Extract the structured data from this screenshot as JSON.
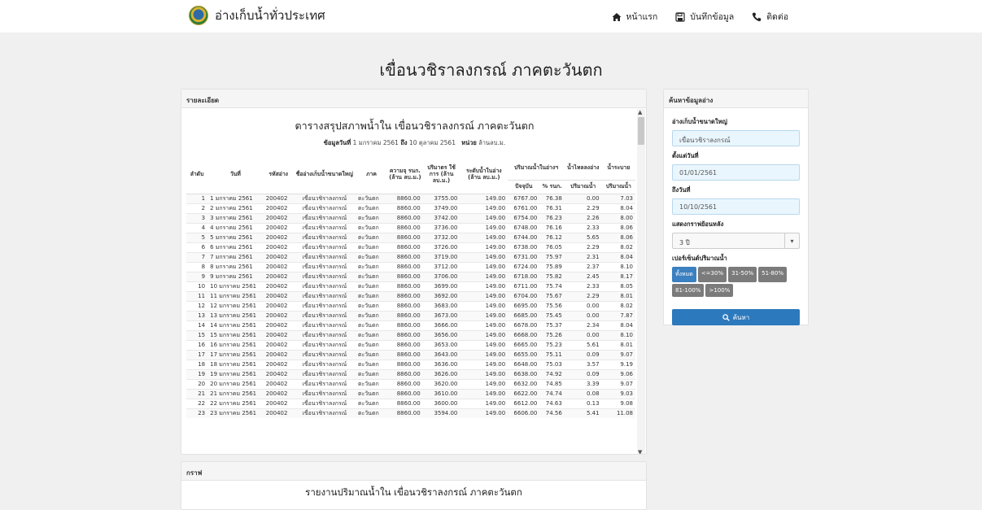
{
  "nav": {
    "brand": "อ่างเก็บน้ำทั่วประเทศ",
    "home": "หน้าแรก",
    "record": "บันทึกข้อมูล",
    "contact": "ติดต่อ"
  },
  "page_title": "เขื่อนวชิราลงกรณ์ ภาคตะวันตก",
  "detail": {
    "heading": "รายละเอียด",
    "report_title": "ตารางสรุปสภาพน้ำใน เขื่อนวชิราลงกรณ์ ภาคตะวันตก",
    "sub_label_date": "ข้อมูลวันที่",
    "sub_date_from": "1 มกราคม 2561",
    "sub_label_to": "ถึง",
    "sub_date_to": "10 ตุลาคม 2561",
    "sub_label_unit": "หน่วย",
    "sub_unit": "ล้านลบ.ม.",
    "columns": {
      "no": "ลำดับ",
      "date": "วันที่",
      "code": "รหัสอ่าง",
      "name": "ชื่ออ่างเก็บน้ำขนาดใหญ่",
      "region": "ภาค",
      "capacity": "ความจุ รนก. (ล้าน ลบ.ม.)",
      "usable": "ปริมาตร ใช้การ (ล้าน ลบ.ม.)",
      "min_level": "ระดับน้ำในอ่าง (ล้าน ลบ.ม.)",
      "storage_group": "ปริมาณน้ำในอ่างฯ",
      "current": "ปัจจุบัน",
      "percent": "% รนก.",
      "inflow_group": "น้ำไหลลงอ่าง",
      "inflow": "ปริมาณน้ำ",
      "release_group": "น้ำระบาย",
      "release": "ปริมาณน้ำ"
    },
    "rows": [
      [
        "1",
        "1 มกราคม 2561",
        "200402",
        "เขื่อนวชิราลงกรณ์",
        "ตะวันตก",
        "8860.00",
        "3755.00",
        "149.00",
        "6767.00",
        "76.38",
        "0.00",
        "7.03"
      ],
      [
        "2",
        "2 มกราคม 2561",
        "200402",
        "เขื่อนวชิราลงกรณ์",
        "ตะวันตก",
        "8860.00",
        "3749.00",
        "149.00",
        "6761.00",
        "76.31",
        "2.29",
        "8.04"
      ],
      [
        "3",
        "3 มกราคม 2561",
        "200402",
        "เขื่อนวชิราลงกรณ์",
        "ตะวันตก",
        "8860.00",
        "3742.00",
        "149.00",
        "6754.00",
        "76.23",
        "2.26",
        "8.00"
      ],
      [
        "4",
        "4 มกราคม 2561",
        "200402",
        "เขื่อนวชิราลงกรณ์",
        "ตะวันตก",
        "8860.00",
        "3736.00",
        "149.00",
        "6748.00",
        "76.16",
        "2.33",
        "8.06"
      ],
      [
        "5",
        "5 มกราคม 2561",
        "200402",
        "เขื่อนวชิราลงกรณ์",
        "ตะวันตก",
        "8860.00",
        "3732.00",
        "149.00",
        "6744.00",
        "76.12",
        "5.65",
        "8.06"
      ],
      [
        "6",
        "6 มกราคม 2561",
        "200402",
        "เขื่อนวชิราลงกรณ์",
        "ตะวันตก",
        "8860.00",
        "3726.00",
        "149.00",
        "6738.00",
        "76.05",
        "2.29",
        "8.02"
      ],
      [
        "7",
        "7 มกราคม 2561",
        "200402",
        "เขื่อนวชิราลงกรณ์",
        "ตะวันตก",
        "8860.00",
        "3719.00",
        "149.00",
        "6731.00",
        "75.97",
        "2.31",
        "8.04"
      ],
      [
        "8",
        "8 มกราคม 2561",
        "200402",
        "เขื่อนวชิราลงกรณ์",
        "ตะวันตก",
        "8860.00",
        "3712.00",
        "149.00",
        "6724.00",
        "75.89",
        "2.37",
        "8.10"
      ],
      [
        "9",
        "9 มกราคม 2561",
        "200402",
        "เขื่อนวชิราลงกรณ์",
        "ตะวันตก",
        "8860.00",
        "3706.00",
        "149.00",
        "6718.00",
        "75.82",
        "2.45",
        "8.17"
      ],
      [
        "10",
        "10 มกราคม 2561",
        "200402",
        "เขื่อนวชิราลงกรณ์",
        "ตะวันตก",
        "8860.00",
        "3699.00",
        "149.00",
        "6711.00",
        "75.74",
        "2.33",
        "8.05"
      ],
      [
        "11",
        "11 มกราคม 2561",
        "200402",
        "เขื่อนวชิราลงกรณ์",
        "ตะวันตก",
        "8860.00",
        "3692.00",
        "149.00",
        "6704.00",
        "75.67",
        "2.29",
        "8.01"
      ],
      [
        "12",
        "12 มกราคม 2561",
        "200402",
        "เขื่อนวชิราลงกรณ์",
        "ตะวันตก",
        "8860.00",
        "3683.00",
        "149.00",
        "6695.00",
        "75.56",
        "0.00",
        "8.02"
      ],
      [
        "13",
        "13 มกราคม 2561",
        "200402",
        "เขื่อนวชิราลงกรณ์",
        "ตะวันตก",
        "8860.00",
        "3673.00",
        "149.00",
        "6685.00",
        "75.45",
        "0.00",
        "7.87"
      ],
      [
        "14",
        "14 มกราคม 2561",
        "200402",
        "เขื่อนวชิราลงกรณ์",
        "ตะวันตก",
        "8860.00",
        "3666.00",
        "149.00",
        "6678.00",
        "75.37",
        "2.34",
        "8.04"
      ],
      [
        "15",
        "15 มกราคม 2561",
        "200402",
        "เขื่อนวชิราลงกรณ์",
        "ตะวันตก",
        "8860.00",
        "3656.00",
        "149.00",
        "6668.00",
        "75.26",
        "0.00",
        "8.10"
      ],
      [
        "16",
        "16 มกราคม 2561",
        "200402",
        "เขื่อนวชิราลงกรณ์",
        "ตะวันตก",
        "8860.00",
        "3653.00",
        "149.00",
        "6665.00",
        "75.23",
        "5.61",
        "8.01"
      ],
      [
        "17",
        "17 มกราคม 2561",
        "200402",
        "เขื่อนวชิราลงกรณ์",
        "ตะวันตก",
        "8860.00",
        "3643.00",
        "149.00",
        "6655.00",
        "75.11",
        "0.09",
        "9.07"
      ],
      [
        "18",
        "18 มกราคม 2561",
        "200402",
        "เขื่อนวชิราลงกรณ์",
        "ตะวันตก",
        "8860.00",
        "3636.00",
        "149.00",
        "6648.00",
        "75.03",
        "3.57",
        "9.19"
      ],
      [
        "19",
        "19 มกราคม 2561",
        "200402",
        "เขื่อนวชิราลงกรณ์",
        "ตะวันตก",
        "8860.00",
        "3626.00",
        "149.00",
        "6638.00",
        "74.92",
        "0.09",
        "9.06"
      ],
      [
        "20",
        "20 มกราคม 2561",
        "200402",
        "เขื่อนวชิราลงกรณ์",
        "ตะวันตก",
        "8860.00",
        "3620.00",
        "149.00",
        "6632.00",
        "74.85",
        "3.39",
        "9.07"
      ],
      [
        "21",
        "21 มกราคม 2561",
        "200402",
        "เขื่อนวชิราลงกรณ์",
        "ตะวันตก",
        "8860.00",
        "3610.00",
        "149.00",
        "6622.00",
        "74.74",
        "0.08",
        "9.03"
      ],
      [
        "22",
        "22 มกราคม 2561",
        "200402",
        "เขื่อนวชิราลงกรณ์",
        "ตะวันตก",
        "8860.00",
        "3600.00",
        "149.00",
        "6612.00",
        "74.63",
        "0.13",
        "9.08"
      ],
      [
        "23",
        "23 มกราคม 2561",
        "200402",
        "เขื่อนวชิราลงกรณ์",
        "ตะวันตก",
        "8860.00",
        "3594.00",
        "149.00",
        "6606.00",
        "74.56",
        "5.41",
        "11.08"
      ]
    ]
  },
  "search": {
    "heading": "ค้นหาข้อมูลอ่าง",
    "dam_label": "อ่างเก็บน้ำขนาดใหญ่",
    "dam_value": "เขื่อนวชิราลงกรณ์",
    "start_label": "ตั้งแต่วันที่",
    "start_value": "01/01/2561",
    "end_label": "ถึงวันที่",
    "end_value": "10/10/2561",
    "graph_label": "แสดงกราฟย้อนหลัง",
    "graph_value": "3 ปี",
    "percent_label": "เปอร์เซ็นต์ปริมาณน้ำ",
    "percent_buttons": [
      "ทั้งหมด",
      "<=30%",
      "31-50%",
      "51-80%",
      "81-100%",
      ">100%"
    ],
    "submit": "ค้นหา"
  },
  "graph": {
    "heading": "กราฟ",
    "title": "รายงานปริมาณน้ำใน เขื่อนวชิราลงกรณ์ ภาคตะวันตก"
  },
  "colors": {
    "accent": "#2d79bd",
    "field_bg": "#eaf6fd",
    "button_gray": "#7b7b7b"
  }
}
